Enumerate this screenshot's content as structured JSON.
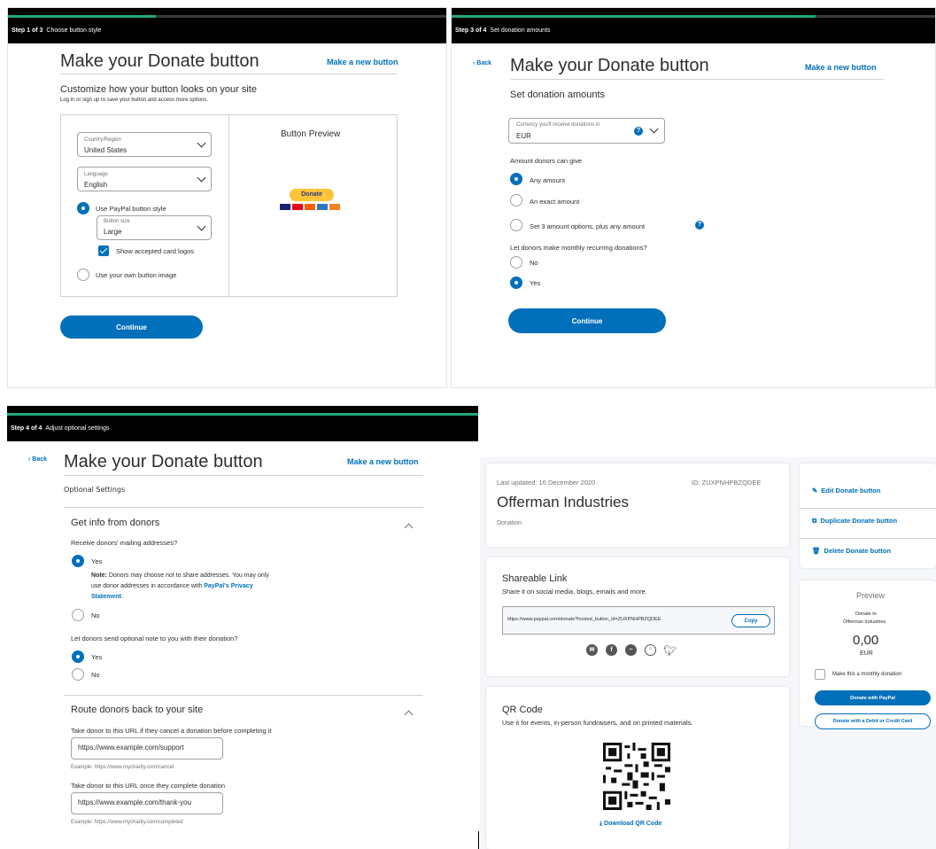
{
  "panel1": {
    "step_num": "Step 1 of 3",
    "step_text": "Choose button style",
    "progress": 0.333,
    "title": "Make your Donate button",
    "new_button_link": "Make a new button",
    "subtitle": "Customize how your button looks on your site",
    "subtitle_note": "Log in or sign up to save your button and access more options.",
    "country_label": "Country/Region",
    "country_value": "United States",
    "language_label": "Language",
    "language_value": "English",
    "style_option_paypal": "Use PayPal button style",
    "size_label": "Button size",
    "size_value": "Large",
    "card_logos_label": "Show accepted card logos",
    "style_option_own": "Use your own button image",
    "preview_title": "Button Preview",
    "donate_button_label": "Donate",
    "continue_label": "Continue"
  },
  "panel2": {
    "step_num": "Step 3 of 4",
    "step_text": "Set donation amounts",
    "progress": 0.75,
    "back_label": "Back",
    "title": "Make your Donate button",
    "new_button_link": "Make a new button",
    "section_title": "Set donation amounts",
    "currency_label": "Currency you'll receive donations in",
    "currency_value": "EUR",
    "amount_question": "Amount donors can give",
    "opt_any": "Any amount",
    "opt_exact": "An exact amount",
    "opt_three": "Set 3 amount options, plus any amount",
    "monthly_question": "Let donors make monthly recurring donations?",
    "opt_no": "No",
    "opt_yes": "Yes",
    "continue_label": "Continue"
  },
  "panel3": {
    "step_num": "Step 4 of 4",
    "step_text": "Adjust optional settings",
    "progress": 1.0,
    "back_label": "Back",
    "title": "Make your Donate button",
    "new_button_link": "Make a new button",
    "optional_heading": "Optional Settings",
    "section1_title": "Get info from donors",
    "mailing_question": "Receive donors' mailing addresses?",
    "yes1": "Yes",
    "note_bold": "Note:",
    "note_line1": "Donors may choose not to share addresses. You may only",
    "note_line2": "use donor addresses in accordance with",
    "privacy_link": "PayPal's Privacy",
    "privacy_link2": "Statement",
    "period": ".",
    "no1": "No",
    "note_question": "Let donors send optional note to you with their donation?",
    "yes2": "Yes",
    "no2": "No",
    "section2_title": "Route donors back to your site",
    "cancel_label": "Take donor to this URL if they cancel a donation before completing it",
    "cancel_value": "https://www.example.com/support",
    "cancel_example": "Example: https://www.mycharity.com/cancel",
    "complete_label": "Take donor to this URL once they complete donation",
    "complete_value": "https://www.example.com/thank-you",
    "complete_example": "Example: https://www.mycharity.com/completed"
  },
  "panel4": {
    "last_updated": "Last updated: 16 December 2020",
    "button_id": "ID: ZUXPNHPBZQDEE",
    "org_name": "Offerman Industries",
    "type": "Donation",
    "share_title": "Shareable Link",
    "share_desc": "Share it on social media, blogs, emails and more.",
    "share_url": "https://www.paypal.com/donate?hosted_button_id=ZUXPNHPBZQDEE",
    "copy_label": "Copy",
    "qr_title": "QR Code",
    "qr_desc": "Use it for events, in-person fundraisers, and on printed materials.",
    "download_qr": "Download QR Code",
    "edit_label": "Edit Donate button",
    "duplicate_label": "Duplicate Donate button",
    "delete_label": "Delete Donate button",
    "preview_title": "Preview",
    "donate_to": "Donate to",
    "preview_org": "Offerman Industries",
    "amount": "0,00",
    "currency": "EUR",
    "monthly_label": "Make this a monthly donation",
    "donate_paypal": "Donate with PayPal",
    "donate_card": "Donate with a Debit or Credit Card"
  },
  "colors": {
    "accent": "#0070ba",
    "progress": "#1fa87a",
    "donate_yellow": "#ffc439"
  }
}
